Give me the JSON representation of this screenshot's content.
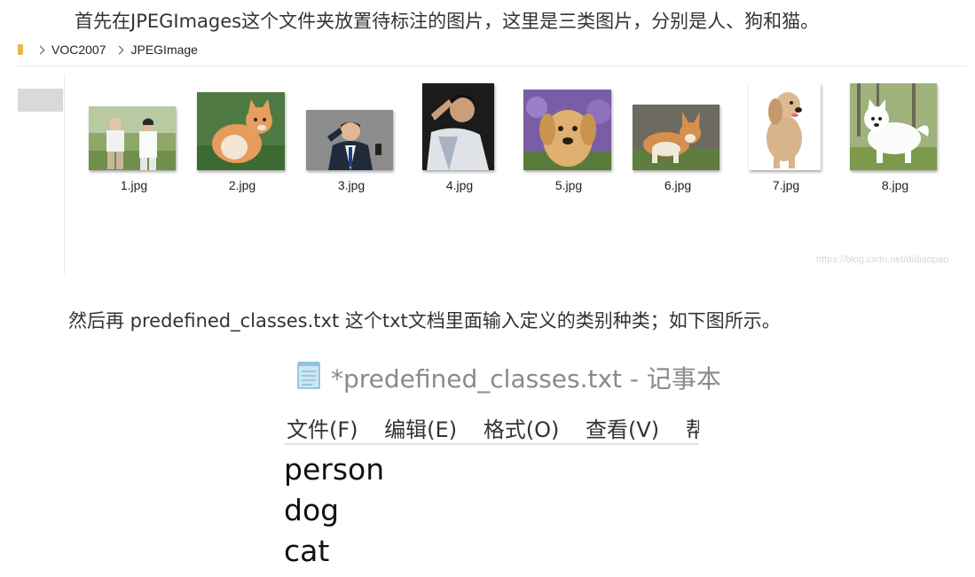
{
  "article": {
    "paragraph1": "首先在JPEGImages这个文件夹放置待标注的图片，这里是三类图片，分别是人、狗和猫。",
    "paragraph2": "然后再 predefined_classes.txt 这个txt文档里面输入定义的类别种类；如下图所示。",
    "watermark": "https://blog.csdn.net/didiaopao"
  },
  "explorer": {
    "breadcrumb": [
      "VOC2007",
      "JPEGImage"
    ],
    "folder_icon": "folder-icon",
    "files": [
      {
        "name": "1.jpg",
        "subject": "elderly couple outdoors"
      },
      {
        "name": "2.jpg",
        "subject": "orange kitten"
      },
      {
        "name": "3.jpg",
        "subject": "man shouting at phone"
      },
      {
        "name": "4.jpg",
        "subject": "man in white shirt"
      },
      {
        "name": "5.jpg",
        "subject": "golden retriever puppy"
      },
      {
        "name": "6.jpg",
        "subject": "corgi on grass"
      },
      {
        "name": "7.jpg",
        "subject": "spaniel puppy"
      },
      {
        "name": "8.jpg",
        "subject": "white samoyed"
      }
    ]
  },
  "notepad": {
    "title": "*predefined_classes.txt - 记事本",
    "menu": [
      "文件(F)",
      "编辑(E)",
      "格式(O)",
      "查看(V)",
      "帮助(H)"
    ],
    "lines": [
      "person",
      "dog",
      "cat"
    ]
  }
}
